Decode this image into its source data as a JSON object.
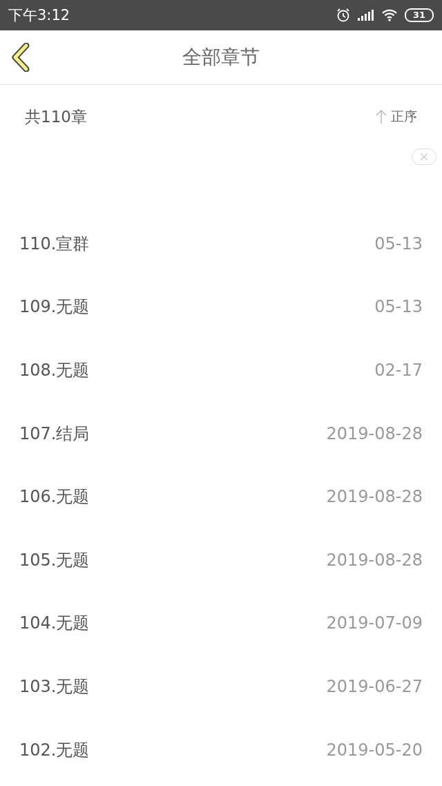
{
  "status_bar": {
    "time": "下午3:12",
    "battery": "31"
  },
  "header": {
    "title": "全部章节"
  },
  "summary": {
    "count": "共110章",
    "sort": "正序"
  },
  "chapters": [
    {
      "title": "110.宣群",
      "date": "05-13"
    },
    {
      "title": "109.无题",
      "date": "05-13"
    },
    {
      "title": "108.无题",
      "date": "02-17"
    },
    {
      "title": "107.结局",
      "date": "2019-08-28"
    },
    {
      "title": "106.无题",
      "date": "2019-08-28"
    },
    {
      "title": "105.无题",
      "date": "2019-08-28"
    },
    {
      "title": "104.无题",
      "date": "2019-07-09"
    },
    {
      "title": "103.无题",
      "date": "2019-06-27"
    },
    {
      "title": "102.无题",
      "date": "2019-05-20"
    }
  ]
}
